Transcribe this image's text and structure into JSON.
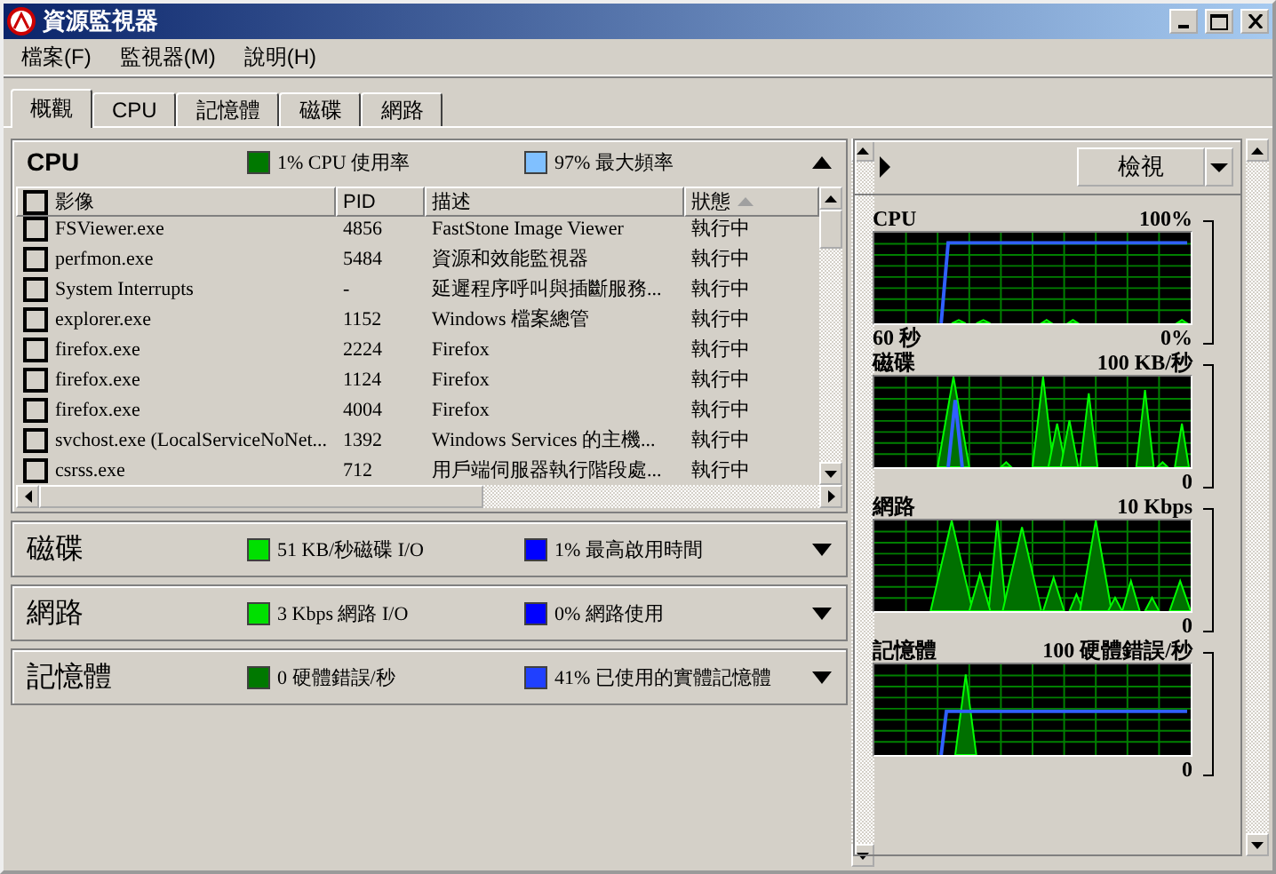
{
  "window": {
    "title": "資源監視器"
  },
  "menu": [
    "檔案(F)",
    "監視器(M)",
    "說明(H)"
  ],
  "tabs": [
    {
      "label": "概觀",
      "selected": true
    },
    {
      "label": "CPU",
      "selected": false
    },
    {
      "label": "記憶體",
      "selected": false
    },
    {
      "label": "磁碟",
      "selected": false
    },
    {
      "label": "網路",
      "selected": false
    }
  ],
  "sections": [
    {
      "title": "CPU",
      "expanded": true,
      "stats": [
        {
          "text": "1% CPU 使用率",
          "color": "#007800"
        },
        {
          "text": "97% 最大頻率",
          "color": "#80c0ff"
        }
      ],
      "table": {
        "all_checked": false,
        "columns": [
          {
            "label": "影像",
            "sorted": false
          },
          {
            "label": "PID",
            "sorted": false
          },
          {
            "label": "描述",
            "sorted": false
          },
          {
            "label": "狀態",
            "sorted": true
          }
        ],
        "rows": [
          {
            "checked": false,
            "cells": [
              "FSViewer.exe",
              "4856",
              "FastStone Image Viewer",
              "執行中"
            ]
          },
          {
            "checked": false,
            "cells": [
              "perfmon.exe",
              "5484",
              "資源和效能監視器",
              "執行中"
            ]
          },
          {
            "checked": false,
            "cells": [
              "System Interrupts",
              "-",
              "延遲程序呼叫與插斷服務...",
              "執行中"
            ]
          },
          {
            "checked": false,
            "cells": [
              "explorer.exe",
              "1152",
              "Windows 檔案總管",
              "執行中"
            ]
          },
          {
            "checked": false,
            "cells": [
              "firefox.exe",
              "2224",
              "Firefox",
              "執行中"
            ]
          },
          {
            "checked": false,
            "cells": [
              "firefox.exe",
              "1124",
              "Firefox",
              "執行中"
            ]
          },
          {
            "checked": false,
            "cells": [
              "firefox.exe",
              "4004",
              "Firefox",
              "執行中"
            ]
          },
          {
            "checked": false,
            "cells": [
              "svchost.exe (LocalServiceNoNet...",
              "1392",
              "Windows Services 的主機...",
              "執行中"
            ]
          },
          {
            "checked": false,
            "cells": [
              "csrss.exe",
              "712",
              "用戶端伺服器執行階段處...",
              "執行中"
            ]
          }
        ]
      }
    },
    {
      "title": "磁碟",
      "expanded": false,
      "stats": [
        {
          "text": "51 KB/秒磁碟 I/O",
          "color": "#00e000"
        },
        {
          "text": "1% 最高啟用時間",
          "color": "#0000ff"
        }
      ]
    },
    {
      "title": "網路",
      "expanded": false,
      "stats": [
        {
          "text": "3 Kbps 網路 I/O",
          "color": "#00e000"
        },
        {
          "text": "0% 網路使用",
          "color": "#0000ff"
        }
      ]
    },
    {
      "title": "記憶體",
      "expanded": false,
      "stats": [
        {
          "text": "0 硬體錯誤/秒",
          "color": "#007800"
        },
        {
          "text": "41% 已使用的實體記憶體",
          "color": "#2040ff"
        }
      ]
    }
  ],
  "side": {
    "view_button": "檢視",
    "graphs": [
      {
        "kind": "cpu",
        "title": "CPU",
        "scale_max": "100%",
        "time_label": "60 秒",
        "scale_min": "0%"
      },
      {
        "kind": "disk",
        "title": "磁碟",
        "scale_max": "100 KB/秒",
        "scale_min": "0"
      },
      {
        "kind": "network",
        "title": "網路",
        "scale_max": "10 Kbps",
        "scale_min": "0"
      },
      {
        "kind": "memory",
        "title": "記憶體",
        "scale_max": "100 硬體錯誤/秒",
        "scale_min": "0"
      }
    ]
  }
}
